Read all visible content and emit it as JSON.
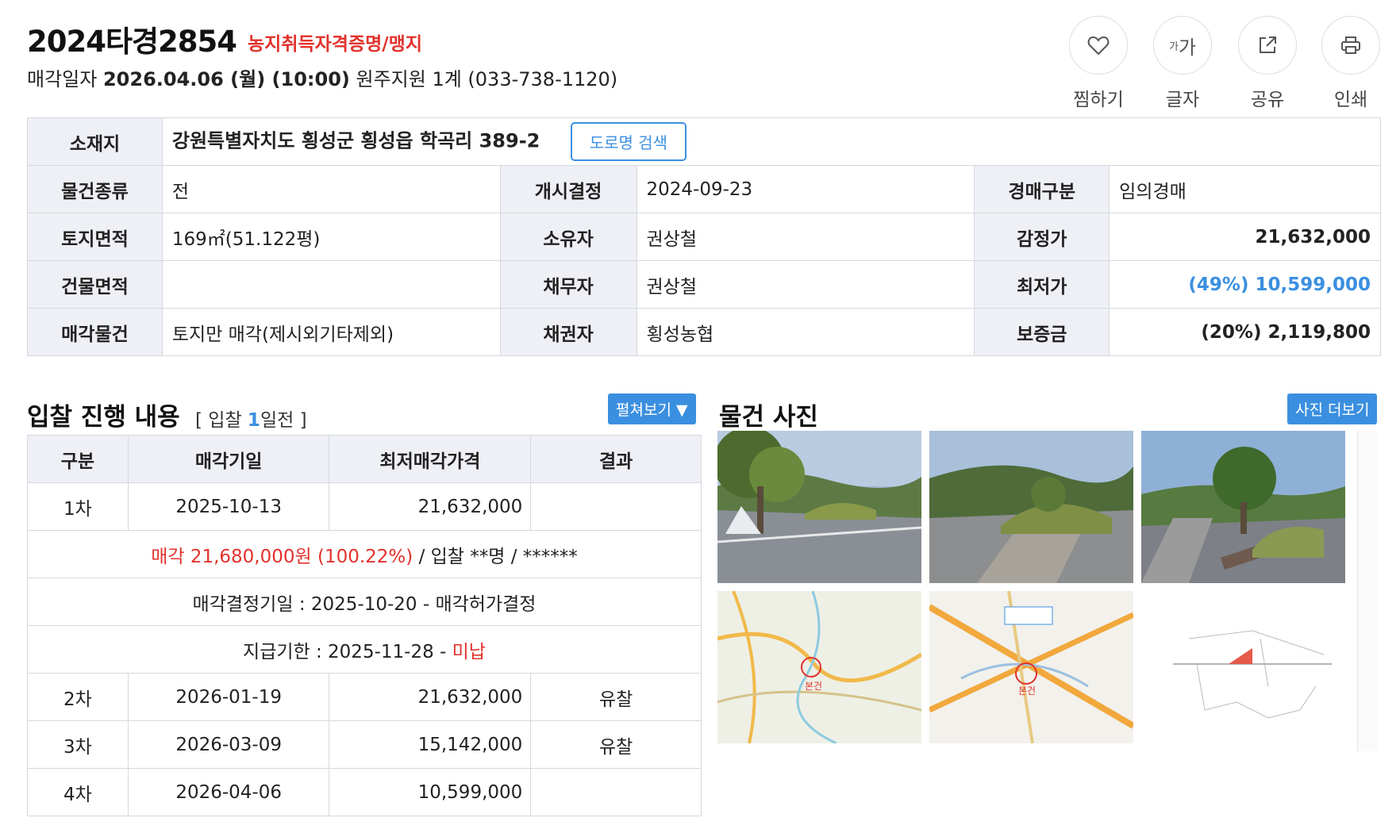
{
  "header": {
    "case_number": "2024타경2854",
    "case_tag": "농지취득자격증명/맹지",
    "sale_label": "매각일자",
    "sale_datetime": "2026.04.06 (월) (10:00)",
    "court": "원주지원 1계 (033-738-1120)"
  },
  "actions": [
    {
      "label": "찜하기",
      "icon": "heart-icon"
    },
    {
      "label": "글자",
      "icon": "font-size-icon",
      "glyph_small": "가",
      "glyph_large": "가"
    },
    {
      "label": "공유",
      "icon": "share-icon"
    },
    {
      "label": "인쇄",
      "icon": "print-icon"
    }
  ],
  "info": {
    "address_label": "소재지",
    "address": "강원특별자치도 횡성군 횡성읍 학곡리 389-2",
    "road_button": "도로명 검색",
    "rows": [
      [
        {
          "h": "물건종류",
          "v": "전"
        },
        {
          "h": "개시결정",
          "v": "2024-09-23"
        },
        {
          "h": "경매구분",
          "v": "임의경매"
        }
      ],
      [
        {
          "h": "토지면적",
          "v": "169㎡(51.122평)"
        },
        {
          "h": "소유자",
          "v": "권상철"
        },
        {
          "h": "감정가",
          "v": "21,632,000"
        }
      ],
      [
        {
          "h": "건물면적",
          "v": ""
        },
        {
          "h": "채무자",
          "v": "권상철"
        },
        {
          "h": "최저가",
          "v": "(49%) 10,599,000"
        }
      ],
      [
        {
          "h": "매각물건",
          "v": "토지만 매각(제시외기타제외)"
        },
        {
          "h": "채권자",
          "v": "횡성농협"
        },
        {
          "h": "보증금",
          "v": "(20%) 2,119,800"
        }
      ]
    ]
  },
  "bids_section": {
    "title": "입찰 진행 내용",
    "sub_prefix": "[ 입찰 ",
    "sub_count": "1",
    "sub_suffix": "일전 ]",
    "expand_button": "펼쳐보기 ▼",
    "headers": [
      "구분",
      "매각기일",
      "최저매각가격",
      "결과"
    ],
    "rounds": [
      {
        "round": "1차",
        "date": "2025-10-13",
        "price": "21,632,000",
        "result": ""
      },
      {
        "round": "2차",
        "date": "2026-01-19",
        "price": "21,632,000",
        "result": "유찰"
      },
      {
        "round": "3차",
        "date": "2026-03-09",
        "price": "15,142,000",
        "result": "유찰"
      },
      {
        "round": "4차",
        "date": "2026-04-06",
        "price": "10,599,000",
        "result": ""
      }
    ],
    "sale_result_red": "매각 21,680,000원 (100.22%)",
    "sale_result_rest": " / 입찰 **명 / ******",
    "decision": "매각결정기일 : 2025-10-20 - 매각허가결정",
    "payment_prefix": "지급기한 : 2025-11-28 - ",
    "payment_status": "미납"
  },
  "photos_section": {
    "title": "물건 사진",
    "more_button": "사진 더보기",
    "map1_label": "본건",
    "map2_label": "본건"
  },
  "colors": {
    "accent_blue": "#3b8fe0",
    "alert_red": "#e2322c",
    "header_cell_bg": "#eef0f5",
    "border": "#d5d8de"
  }
}
